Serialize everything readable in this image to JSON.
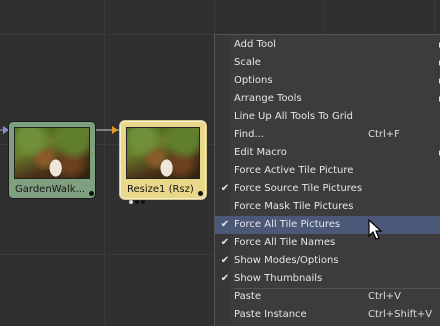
{
  "nodes": [
    {
      "label": "GardenWalk...",
      "color": "#7fa07e"
    },
    {
      "label": "Resize1  (Rsz)",
      "color": "#ead88a"
    }
  ],
  "context_menu": {
    "items": [
      {
        "label": "Add Tool",
        "shortcut": "",
        "checked": false,
        "submenu": true
      },
      {
        "label": "Scale",
        "shortcut": "",
        "checked": false,
        "submenu": true
      },
      {
        "label": "Options",
        "shortcut": "",
        "checked": false,
        "submenu": true
      },
      {
        "label": "Arrange Tools",
        "shortcut": "",
        "checked": false,
        "submenu": true
      },
      {
        "label": "Line Up All Tools To Grid",
        "shortcut": "",
        "checked": false,
        "submenu": false
      },
      {
        "label": "Find...",
        "shortcut": "Ctrl+F",
        "checked": false,
        "submenu": false
      },
      {
        "label": "Edit Macro",
        "shortcut": "",
        "checked": false,
        "submenu": true
      },
      {
        "label": "Force Active Tile Picture",
        "shortcut": "",
        "checked": false,
        "submenu": false
      },
      {
        "label": "Force Source Tile Pictures",
        "shortcut": "",
        "checked": true,
        "submenu": false
      },
      {
        "label": "Force Mask Tile Pictures",
        "shortcut": "",
        "checked": false,
        "submenu": false
      },
      {
        "label": "Force All Tile Pictures",
        "shortcut": "",
        "checked": true,
        "submenu": false,
        "highlighted": true
      },
      {
        "label": "Force All Tile Names",
        "shortcut": "",
        "checked": true,
        "submenu": false
      },
      {
        "label": "Show Modes/Options",
        "shortcut": "",
        "checked": true,
        "submenu": false
      },
      {
        "label": "Show Thumbnails",
        "shortcut": "",
        "checked": true,
        "submenu": false
      },
      {
        "label": "Paste",
        "shortcut": "Ctrl+V",
        "checked": false,
        "submenu": false
      },
      {
        "label": "Paste Instance",
        "shortcut": "Ctrl+Shift+V",
        "checked": false,
        "submenu": false
      }
    ],
    "check_glyph": "✔"
  },
  "colors": {
    "background": "#303030",
    "menu_bg": "#3c3c3c",
    "highlight": "#4b5877",
    "input_triangle": "#8b8bd8",
    "output_triangle": "#e29b2a"
  }
}
